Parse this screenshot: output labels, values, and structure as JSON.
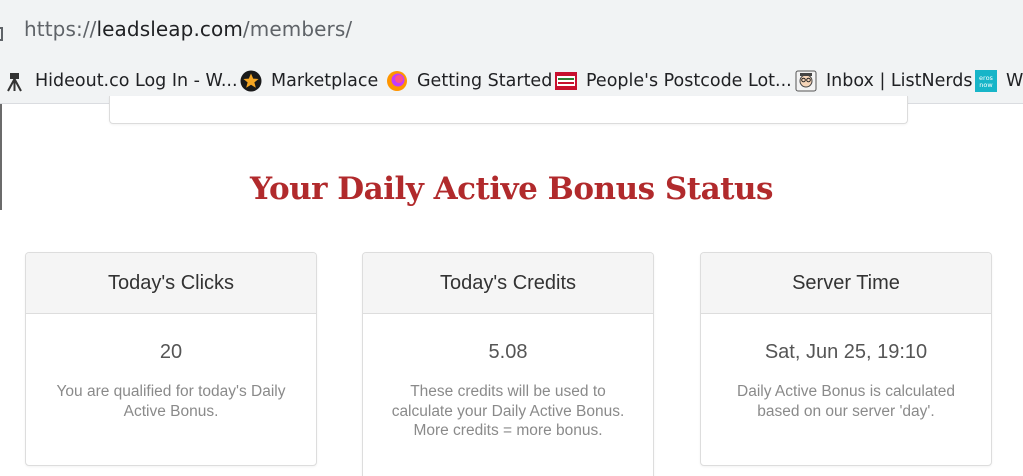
{
  "browser": {
    "url_scheme": "https://",
    "url_host": "leadsleap.com",
    "url_path": "/members/"
  },
  "bookmarks": [
    {
      "label": "Hideout.co Log In - W...",
      "icon": "camera-tripod-icon"
    },
    {
      "label": "Marketplace",
      "icon": "star-badge-icon"
    },
    {
      "label": "Getting Started",
      "icon": "firefox-icon"
    },
    {
      "label": "People's Postcode Lot...",
      "icon": "postcode-lottery-icon"
    },
    {
      "label": "Inbox | ListNerds",
      "icon": "nerd-avatar-icon"
    },
    {
      "label": "W",
      "icon": "erosnow-icon"
    }
  ],
  "section": {
    "title": "Your Daily Active Bonus Status"
  },
  "cards": [
    {
      "title": "Today's Clicks",
      "value": "20",
      "description": "You are qualified for today's Daily Active Bonus."
    },
    {
      "title": "Today's Credits",
      "value": "5.08",
      "description": "These credits will be used to calculate your Daily Active Bonus.",
      "note": "More credits = more bonus."
    },
    {
      "title": "Server Time",
      "value": "Sat, Jun 25, 19:10",
      "description": "Daily Active Bonus is calculated based on our server 'day'."
    }
  ],
  "colors": {
    "title_red": "#b12a2c",
    "browser_chrome": "#f1f3f4",
    "card_header": "#f5f5f5"
  }
}
